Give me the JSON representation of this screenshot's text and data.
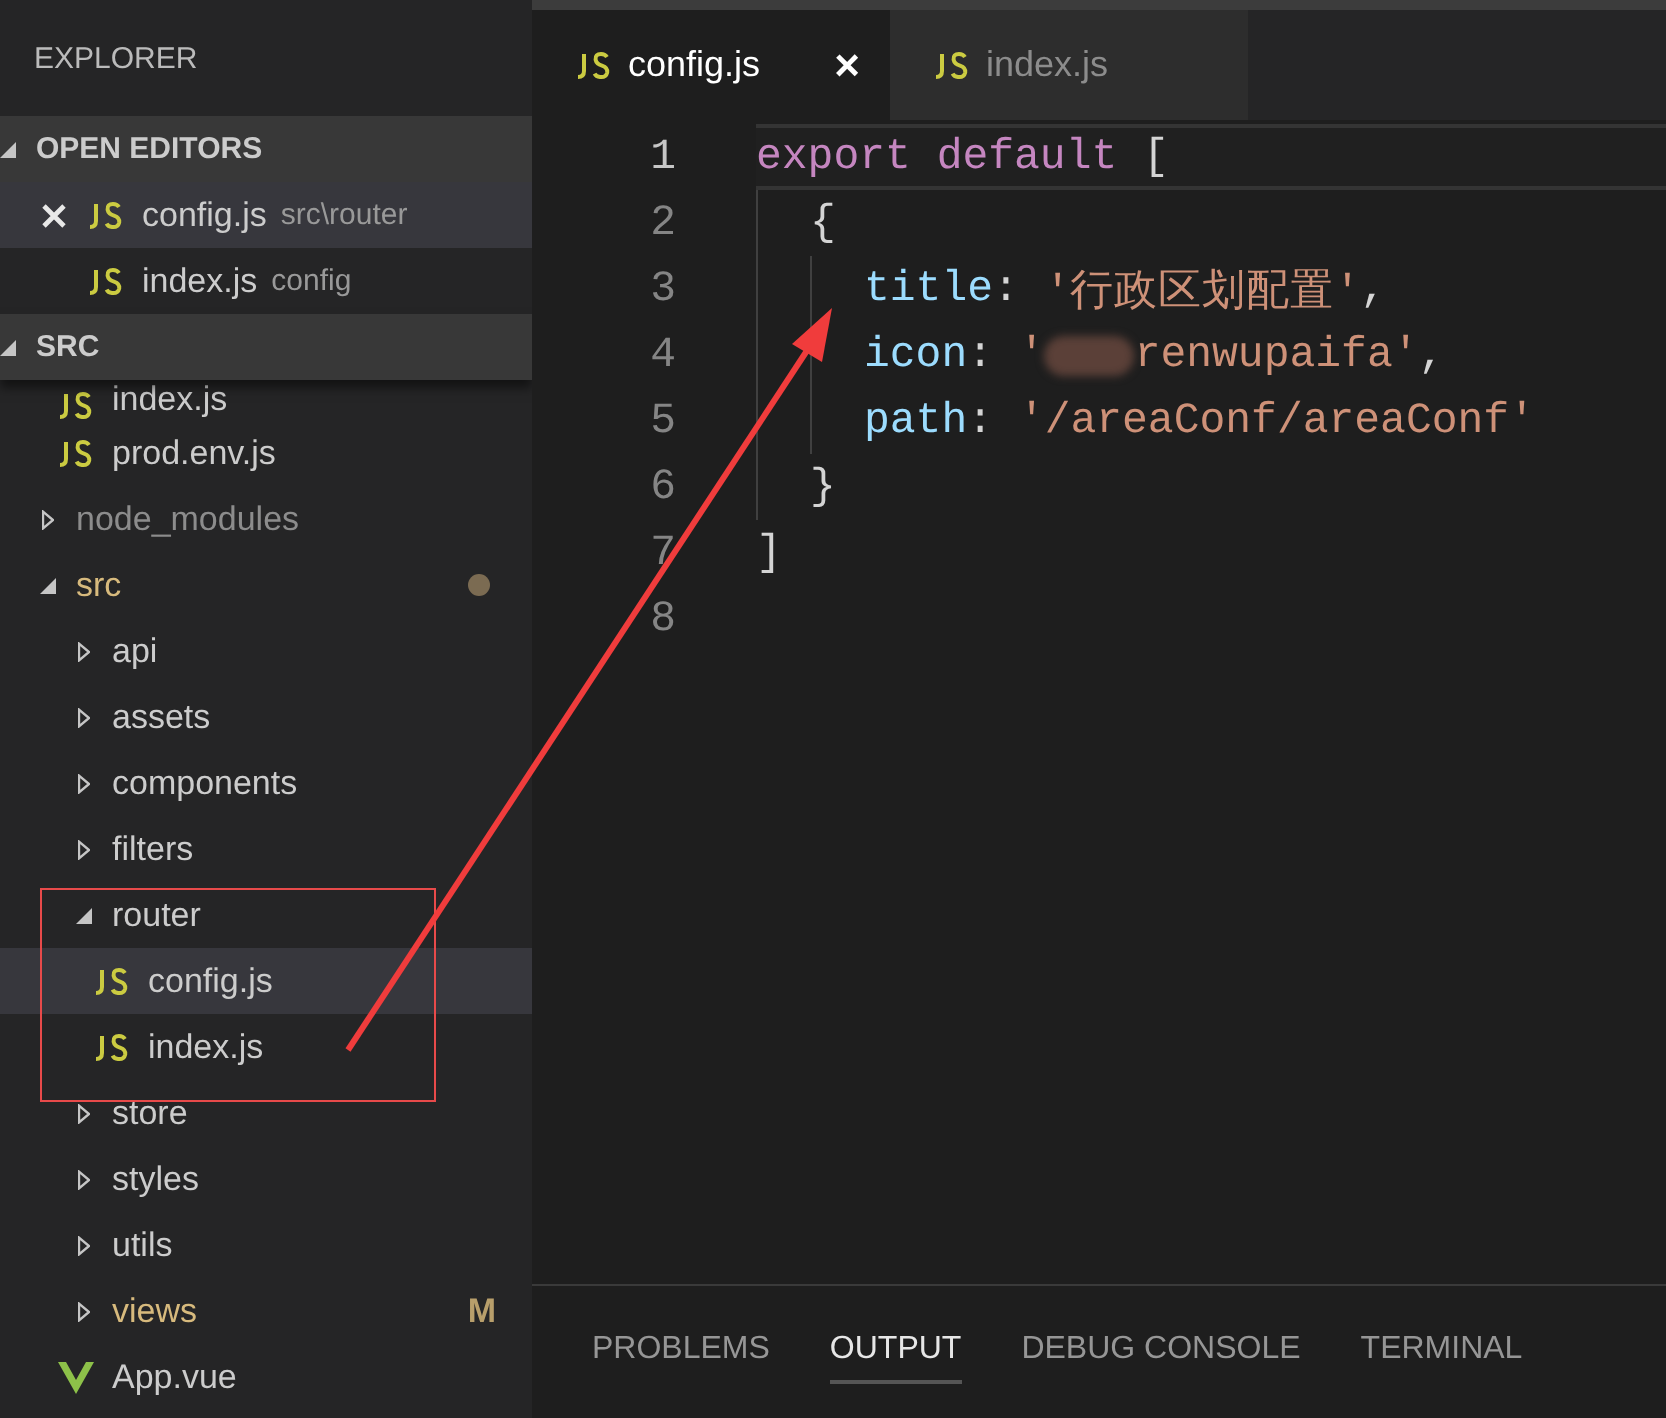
{
  "sidebar": {
    "title": "EXPLORER",
    "open_editors": {
      "label": "OPEN EDITORS",
      "expanded": true,
      "items": [
        {
          "name": "config.js",
          "description": "src\\router",
          "selected": true
        },
        {
          "name": "index.js",
          "description": "config",
          "selected": false
        }
      ]
    },
    "folder": {
      "label": "SRC",
      "expanded": true,
      "tree": [
        {
          "kind": "hidden_parent",
          "children": [
            {
              "kind": "js",
              "name": "index.js",
              "selected": false,
              "modified": false,
              "ignored": false
            },
            {
              "kind": "js",
              "name": "prod.env.js",
              "selected": false,
              "modified": false,
              "ignored": false
            }
          ]
        },
        {
          "kind": "folder",
          "name": "node_modules",
          "expanded": false,
          "selected": false,
          "modified": false,
          "ignored": true,
          "dot": false
        },
        {
          "kind": "folder",
          "name": "src",
          "expanded": true,
          "selected": false,
          "modified": true,
          "ignored": false,
          "dot": true,
          "children": [
            {
              "kind": "folder",
              "name": "api",
              "expanded": false,
              "selected": false,
              "modified": false,
              "ignored": false,
              "dot": false
            },
            {
              "kind": "folder",
              "name": "assets",
              "expanded": false,
              "selected": false,
              "modified": false,
              "ignored": false,
              "dot": false
            },
            {
              "kind": "folder",
              "name": "components",
              "expanded": false,
              "selected": false,
              "modified": false,
              "ignored": false,
              "dot": false
            },
            {
              "kind": "folder",
              "name": "filters",
              "expanded": false,
              "selected": false,
              "modified": false,
              "ignored": false,
              "dot": false
            },
            {
              "kind": "folder",
              "name": "router",
              "expanded": true,
              "selected": false,
              "modified": false,
              "ignored": false,
              "dot": false,
              "children": [
                {
                  "kind": "js",
                  "name": "config.js",
                  "selected": true,
                  "modified": false,
                  "ignored": false
                },
                {
                  "kind": "js",
                  "name": "index.js",
                  "selected": false,
                  "modified": false,
                  "ignored": false
                }
              ]
            },
            {
              "kind": "folder",
              "name": "store",
              "expanded": false,
              "selected": false,
              "modified": false,
              "ignored": false,
              "dot": false
            },
            {
              "kind": "folder",
              "name": "styles",
              "expanded": false,
              "selected": false,
              "modified": false,
              "ignored": false,
              "dot": false
            },
            {
              "kind": "folder",
              "name": "utils",
              "expanded": false,
              "selected": false,
              "modified": false,
              "ignored": false,
              "dot": false
            },
            {
              "kind": "folder",
              "name": "views",
              "expanded": false,
              "selected": false,
              "modified": true,
              "ignored": false,
              "dot": false,
              "badge": "M"
            },
            {
              "kind": "vue",
              "name": "App.vue",
              "selected": false,
              "modified": false,
              "ignored": false
            }
          ]
        }
      ]
    }
  },
  "tabs": [
    {
      "label": "config.js",
      "selected": true,
      "close": "×"
    },
    {
      "label": "index.js",
      "selected": false
    }
  ],
  "editor": {
    "lines": [
      {
        "number": "1",
        "current": true,
        "tokens": [
          {
            "kind": "keyword",
            "text": "export default"
          },
          {
            "kind": "punct",
            "text": " ["
          }
        ],
        "children": [
          {
            "number": "2",
            "current": false,
            "tokens": [
              {
                "kind": "punct",
                "text": "{"
              }
            ],
            "children": [
              {
                "number": "3",
                "current": false,
                "tokens": [
                  {
                    "kind": "property",
                    "text": "title"
                  },
                  {
                    "kind": "punct",
                    "text": ": "
                  },
                  {
                    "kind": "string",
                    "text": "'行政区划配置'"
                  },
                  {
                    "kind": "punct",
                    "text": ","
                  }
                ]
              },
              {
                "number": "4",
                "current": false,
                "tokens": [
                  {
                    "kind": "property",
                    "text": "icon"
                  },
                  {
                    "kind": "punct",
                    "text": ": "
                  },
                  {
                    "kind": "string",
                    "text": "'"
                  },
                  {
                    "kind": "redacted"
                  },
                  {
                    "kind": "string",
                    "text": "renwupaifa'"
                  },
                  {
                    "kind": "punct",
                    "text": ","
                  }
                ]
              },
              {
                "number": "5",
                "current": false,
                "tokens": [
                  {
                    "kind": "property",
                    "text": "path"
                  },
                  {
                    "kind": "punct",
                    "text": ": "
                  },
                  {
                    "kind": "string",
                    "text": "'/areaConf/areaConf'"
                  }
                ]
              }
            ]
          },
          {
            "number": "6",
            "current": false,
            "tokens": [
              {
                "kind": "punct",
                "text": "}"
              }
            ]
          }
        ]
      },
      {
        "number": "7",
        "current": false,
        "tokens": [
          {
            "kind": "punct",
            "text": "]"
          }
        ]
      },
      {
        "number": "8",
        "current": false
      }
    ]
  },
  "panel": {
    "tabs": [
      {
        "label": "PROBLEMS",
        "selected": false
      },
      {
        "label": "OUTPUT",
        "selected": true
      },
      {
        "label": "DEBUG CONSOLE",
        "selected": false
      },
      {
        "label": "TERMINAL",
        "selected": false
      }
    ]
  },
  "annotations": [
    {
      "kind": "box"
    },
    {
      "kind": "arrow"
    }
  ]
}
